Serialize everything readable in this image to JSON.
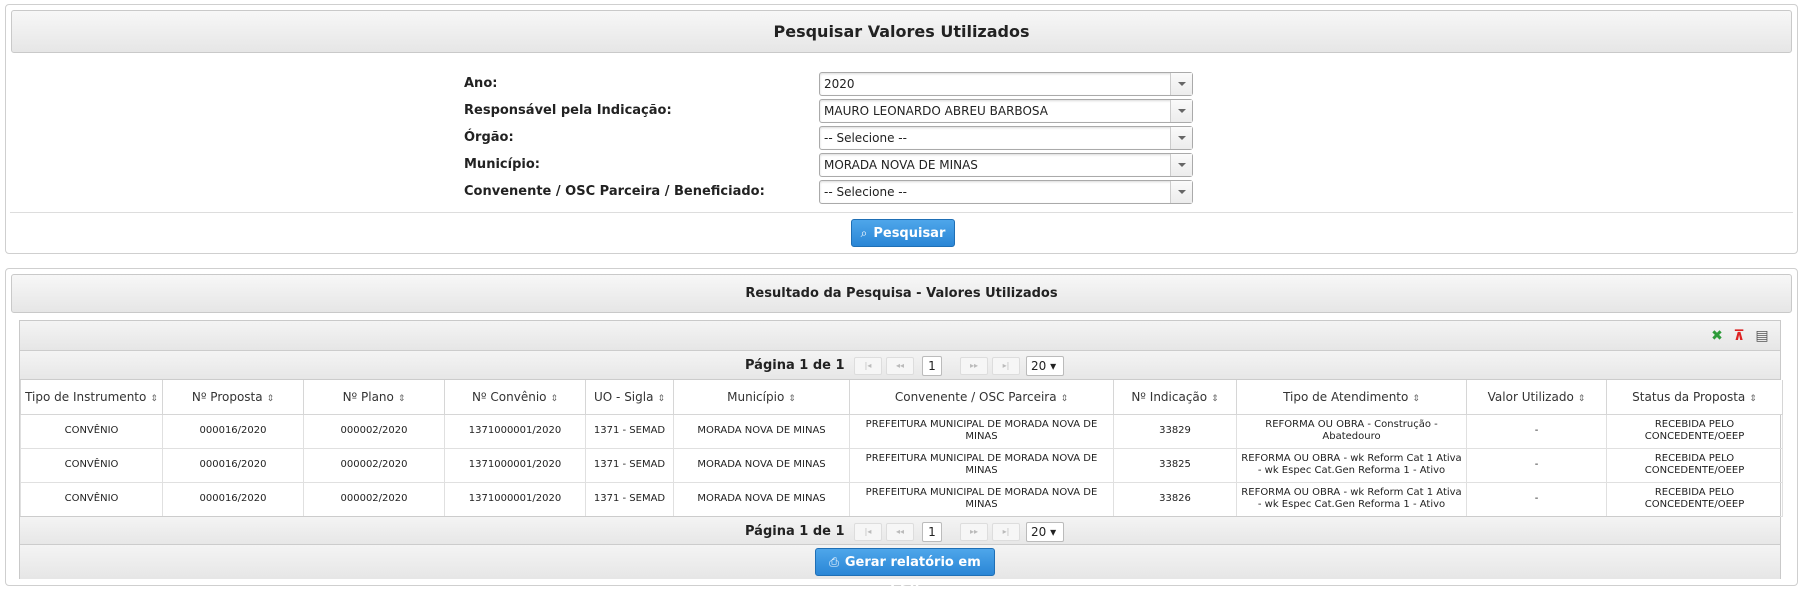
{
  "search": {
    "title": "Pesquisar Valores Utilizados",
    "fields": [
      {
        "label": "Ano:",
        "value": "2020"
      },
      {
        "label": "Responsável pela Indicação:",
        "value": "MAURO LEONARDO ABREU BARBOSA"
      },
      {
        "label": "Órgão:",
        "value": "-- Selecione --"
      },
      {
        "label": "Município:",
        "value": "MORADA NOVA DE MINAS"
      },
      {
        "label": "Convenente / OSC Parceira / Beneficiado:",
        "value": "-- Selecione --"
      }
    ],
    "button_label": "Pesquisar",
    "button_icon": "magnifier-icon"
  },
  "results": {
    "title": "Resultado da Pesquisa - Valores Utilizados",
    "toolbar_icons": [
      "excel-icon",
      "pdf-icon",
      "print-icon"
    ],
    "pager": {
      "text": "Página 1 de 1",
      "current_page": "1",
      "page_size": "20 ▾",
      "first": "|◂",
      "prev": "◂◂",
      "next": "▸▸",
      "last": "▸|"
    },
    "columns": [
      "Tipo de Instrumento",
      "Nº Proposta",
      "Nº Plano",
      "Nº Convênio",
      "UO - Sigla",
      "Município",
      "Convenente / OSC Parceira",
      "Nº Indicação",
      "Tipo de Atendimento",
      "Valor Utilizado",
      "Status da Proposta"
    ],
    "rows": [
      [
        "CONVÊNIO",
        "000016/2020",
        "000002/2020",
        "1371000001/2020",
        "1371 - SEMAD",
        "MORADA NOVA DE MINAS",
        "PREFEITURA MUNICIPAL DE MORADA NOVA DE MINAS",
        "33829",
        "REFORMA OU OBRA - Construção - Abatedouro",
        "-",
        "RECEBIDA PELO CONCEDENTE/OEEP"
      ],
      [
        "CONVÊNIO",
        "000016/2020",
        "000002/2020",
        "1371000001/2020",
        "1371 - SEMAD",
        "MORADA NOVA DE MINAS",
        "PREFEITURA MUNICIPAL DE MORADA NOVA DE MINAS",
        "33825",
        "REFORMA OU OBRA - wk Reform Cat 1 Ativa - wk Espec Cat.Gen Reforma 1 - Ativo",
        "-",
        "RECEBIDA PELO CONCEDENTE/OEEP"
      ],
      [
        "CONVÊNIO",
        "000016/2020",
        "000002/2020",
        "1371000001/2020",
        "1371 - SEMAD",
        "MORADA NOVA DE MINAS",
        "PREFEITURA MUNICIPAL DE MORADA NOVA DE MINAS",
        "33826",
        "REFORMA OU OBRA - wk Reform Cat 1 Ativa - wk Espec Cat.Gen Reforma 1 - Ativo",
        "-",
        "RECEBIDA PELO CONCEDENTE/OEEP"
      ]
    ],
    "csv_button_label": "Gerar relatório em CSV",
    "csv_button_icon": "report-icon"
  },
  "colors": {
    "button": "#2a86d6",
    "header": "#e6e6e6",
    "border": "#c9c9c9"
  }
}
